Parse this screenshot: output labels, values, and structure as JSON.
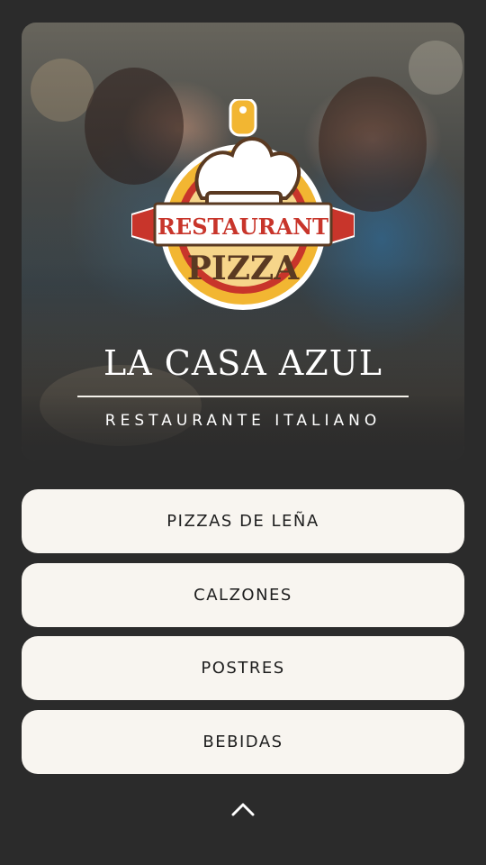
{
  "hero": {
    "logo": {
      "top_text": "RESTAURANT",
      "bottom_text": "PIZZA"
    },
    "title": "LA CASA AZUL",
    "subtitle": "RESTAURANTE ITALIANO"
  },
  "menu": {
    "items": [
      {
        "label": "PIZZAS DE LEÑA"
      },
      {
        "label": "CALZONES"
      },
      {
        "label": "POSTRES"
      },
      {
        "label": "BEBIDAS"
      }
    ]
  },
  "footer": {
    "scroll_top_icon": "chevron-up-icon"
  },
  "colors": {
    "background": "#2b2b2b",
    "button_bg": "#f8f5f0",
    "button_text": "#1e1e1e",
    "logo_red": "#c8352b",
    "logo_yellow": "#f2b632",
    "logo_brown": "#5a3a22"
  }
}
